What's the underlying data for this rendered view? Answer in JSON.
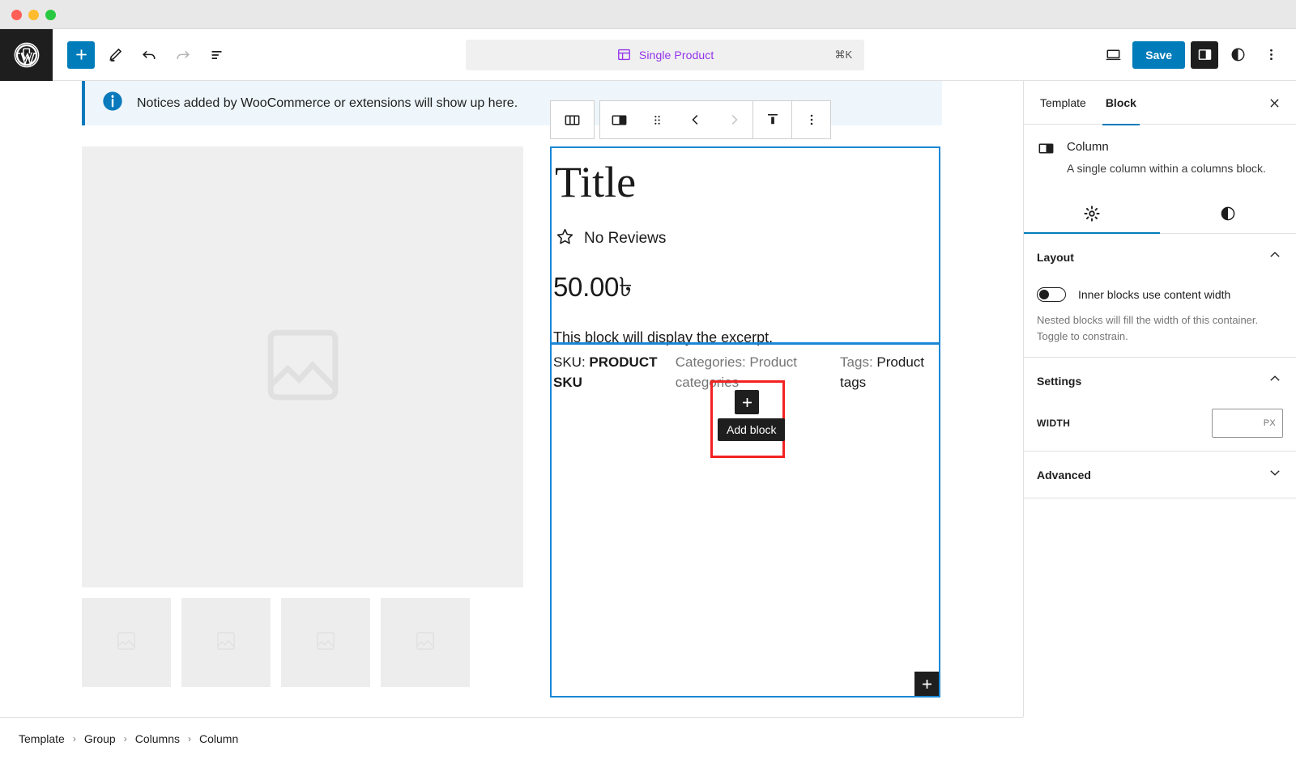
{
  "window": {
    "traffic_lights": [
      "close",
      "minimize",
      "maximize"
    ]
  },
  "toolbar": {
    "logo_icon": "wordpress-logo-icon",
    "add_block_icon": "plus-icon",
    "edit_icon": "pencil-icon",
    "undo_icon": "undo-icon",
    "redo_icon": "redo-icon",
    "list_view_icon": "list-view-icon",
    "document_title": "Single Product",
    "document_icon": "template-icon",
    "command_shortcut": "⌘K",
    "view_icon": "desktop-icon",
    "save_label": "Save",
    "sidebar_icon": "sidebar-panel-icon",
    "styles_icon": "contrast-icon",
    "options_icon": "kebab-menu-icon"
  },
  "canvas": {
    "notice": {
      "icon": "info-icon",
      "text": "Notices added by WooCommerce or extensions will show up here."
    },
    "gallery": {
      "main_image_icon": "image-placeholder-icon",
      "thumbnails": [
        {
          "icon": "image-placeholder-icon"
        },
        {
          "icon": "image-placeholder-icon"
        },
        {
          "icon": "image-placeholder-icon"
        },
        {
          "icon": "image-placeholder-icon"
        }
      ]
    },
    "product": {
      "title": "Title",
      "reviews_icon": "star-outline-icon",
      "reviews_text": "No Reviews",
      "price": "50.00৳",
      "excerpt": "This block will display the excerpt.",
      "meta": {
        "sku_label": "SKU:",
        "sku_value": "PRODUCT SKU",
        "categories_label": "Categories:",
        "categories_value": "Product categories",
        "tags_label": "Tags:",
        "tags_value": "Product tags"
      },
      "corner_appender_icon": "plus-icon"
    },
    "block_toolbar": {
      "parent_block_icon": "columns-icon",
      "block_type_icon": "column-icon",
      "drag_handle_icon": "drag-handle-icon",
      "move_left_icon": "chevron-left-icon",
      "move_right_icon": "chevron-right-icon",
      "vertical_align_icon": "align-top-icon",
      "more_options_icon": "kebab-menu-icon"
    },
    "inserter": {
      "icon": "plus-icon",
      "tooltip": "Add block",
      "highlight_color": "#f32222"
    }
  },
  "sidebar": {
    "tabs": [
      {
        "label": "Template",
        "active": false
      },
      {
        "label": "Block",
        "active": true
      }
    ],
    "close_icon": "close-icon",
    "block": {
      "icon": "column-icon",
      "name": "Column",
      "description": "A single column within a columns block."
    },
    "inner_tabs": [
      {
        "icon": "gear-icon",
        "active": true
      },
      {
        "icon": "contrast-icon",
        "active": false
      }
    ],
    "panels": [
      {
        "title": "Layout",
        "expanded": true,
        "toggle_label": "Inner blocks use content width",
        "toggle_on": false,
        "help": "Nested blocks will fill the width of this container. Toggle to constrain."
      },
      {
        "title": "Settings",
        "expanded": true,
        "width_label": "WIDTH",
        "width_value": "",
        "width_unit": "PX"
      },
      {
        "title": "Advanced",
        "expanded": false
      }
    ]
  },
  "breadcrumb": {
    "items": [
      "Template",
      "Group",
      "Columns",
      "Column"
    ],
    "separator": "›"
  },
  "colors": {
    "accent": "#007cba",
    "selection": "#1a87d6",
    "highlight": "#f32222",
    "template_title": "#9333ea"
  }
}
